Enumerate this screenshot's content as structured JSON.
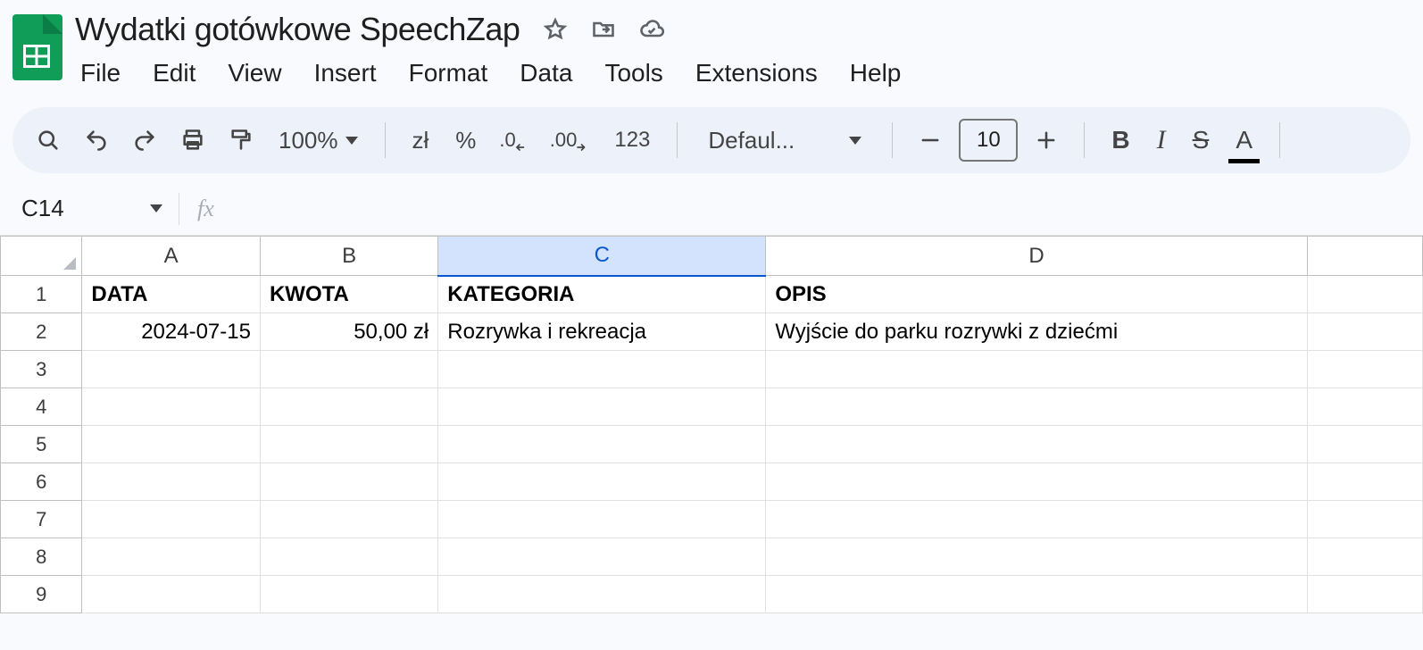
{
  "doc": {
    "title": "Wydatki gotówkowe SpeechZap"
  },
  "menus": [
    "File",
    "Edit",
    "View",
    "Insert",
    "Format",
    "Data",
    "Tools",
    "Extensions",
    "Help"
  ],
  "toolbar": {
    "zoom": "100%",
    "currency": "zł",
    "percent": "%",
    "dec_dec": ".0",
    "inc_dec": ".00",
    "more_fmt": "123",
    "font": "Defaul...",
    "font_size": "10",
    "bold": "B",
    "italic": "I",
    "strike": "S",
    "textcolor": "A"
  },
  "namebox": {
    "ref": "C14"
  },
  "columns": [
    "A",
    "B",
    "C",
    "D"
  ],
  "selected_column": "C",
  "rows": [
    "1",
    "2",
    "3",
    "4",
    "5",
    "6",
    "7",
    "8",
    "9"
  ],
  "data": {
    "headers": {
      "A": "DATA",
      "B": "KWOTA",
      "C": "KATEGORIA",
      "D": "OPIS"
    },
    "row2": {
      "A": "2024-07-15",
      "B": "50,00 zł",
      "C": "Rozrywka i rekreacja",
      "D": "Wyjście do parku rozrywki z dziećmi"
    }
  }
}
